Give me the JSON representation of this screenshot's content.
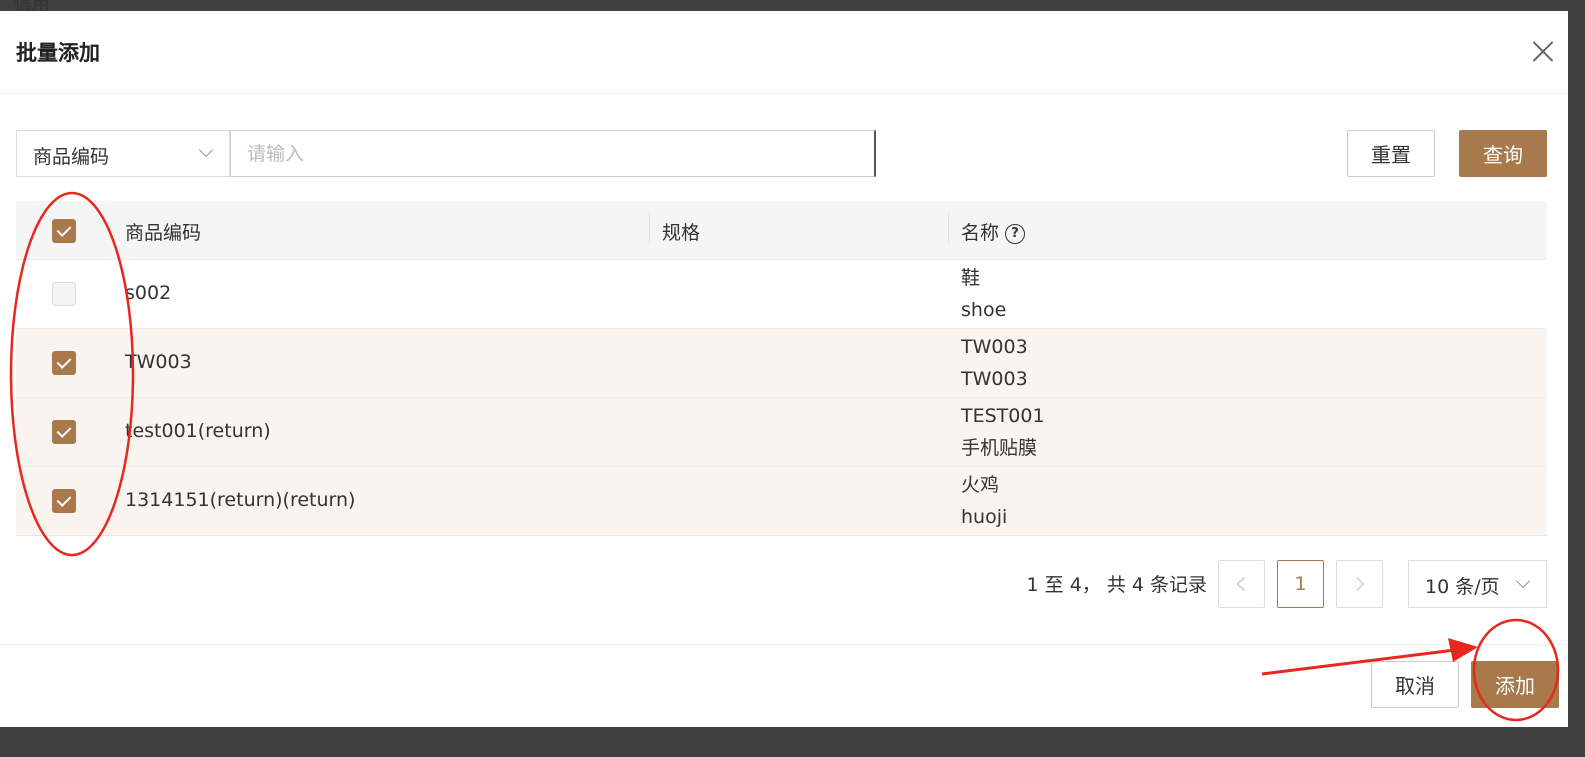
{
  "background": {
    "text": "信用"
  },
  "dialog": {
    "title": "批量添加",
    "search": {
      "field_select": "商品编码",
      "placeholder": "请输入",
      "reset_label": "重置",
      "query_label": "查询"
    },
    "table": {
      "columns": [
        "商品编码",
        "规格",
        "名称"
      ],
      "rows": [
        {
          "code": "s002",
          "spec": "",
          "name_lines": [
            "鞋",
            "shoe"
          ],
          "checked": false
        },
        {
          "code": "TW003",
          "spec": "",
          "name_lines": [
            "TW003",
            "TW003"
          ],
          "checked": true
        },
        {
          "code": "test001(return)",
          "spec": "",
          "name_lines": [
            "TEST001",
            "手机贴膜"
          ],
          "checked": true
        },
        {
          "code": "1314151(return)(return)",
          "spec": "",
          "name_lines": [
            "火鸡",
            "huoji"
          ],
          "checked": true
        }
      ]
    },
    "pagination": {
      "summary": "1 至 4， 共 4 条记录",
      "current_page": "1",
      "page_size": "10 条/页"
    },
    "footer": {
      "cancel_label": "取消",
      "add_label": "添加"
    }
  },
  "colors": {
    "accent": "#a8794a",
    "annotation": "#e8281e"
  }
}
